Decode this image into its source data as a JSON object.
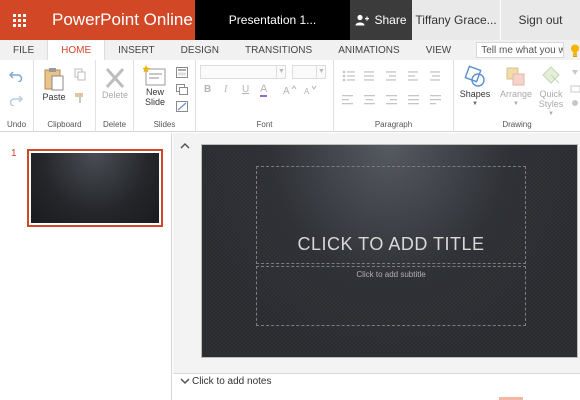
{
  "titlebar": {
    "app_name": "PowerPoint Online",
    "doc_title": "Presentation 1...",
    "share_label": "Share",
    "user_name": "Tiffany Grace...",
    "signout_label": "Sign out"
  },
  "tabs": [
    {
      "label": "FILE"
    },
    {
      "label": "HOME",
      "active": true
    },
    {
      "label": "INSERT"
    },
    {
      "label": "DESIGN"
    },
    {
      "label": "TRANSITIONS"
    },
    {
      "label": "ANIMATIONS"
    },
    {
      "label": "VIEW"
    }
  ],
  "tell_me_placeholder": "Tell me what you want to do",
  "ribbon": {
    "undo": {
      "group_label": "Undo"
    },
    "clipboard": {
      "paste_label": "Paste",
      "group_label": "Clipboard"
    },
    "delete": {
      "delete_label": "Delete",
      "group_label": "Delete"
    },
    "slides": {
      "new_slide_label": "New Slide",
      "group_label": "Slides"
    },
    "font": {
      "group_label": "Font",
      "bold": "B",
      "italic": "I",
      "underline": "U",
      "font_color": "A"
    },
    "paragraph": {
      "group_label": "Paragraph"
    },
    "drawing": {
      "shapes_label": "Shapes",
      "arrange_label": "Arrange",
      "quick_styles_label": "Quick Styles",
      "group_label": "Drawing"
    }
  },
  "thumbnails": [
    {
      "number": "1"
    }
  ],
  "slide": {
    "title_placeholder": "CLICK TO ADD TITLE",
    "subtitle_placeholder": "Click to add subtitle"
  },
  "notes_placeholder": "Click to add notes",
  "colors": {
    "accent": "#d24726",
    "title_dark": "#000000",
    "share_bg": "#3b3b3b",
    "slide_bg": "#2a2c30"
  }
}
